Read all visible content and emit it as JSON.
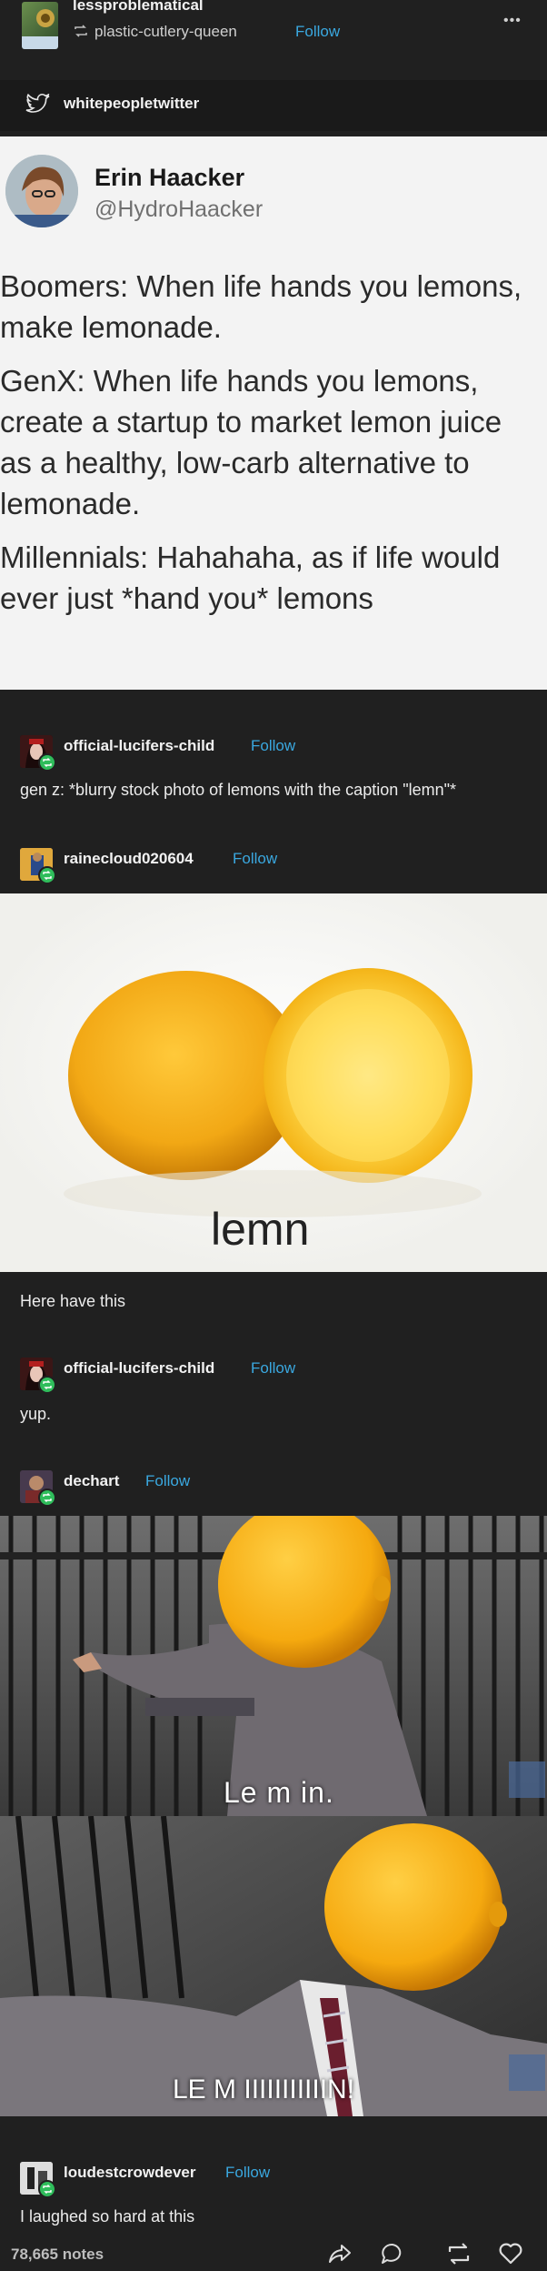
{
  "header": {
    "blog": "lessproblematical",
    "reblogged_from": "plastic-cutlery-queen",
    "follow": "Follow",
    "more": "•••"
  },
  "source": {
    "name": "whitepeopletwitter"
  },
  "tweet": {
    "display_name": "Erin Haacker",
    "handle": "@HydroHaacker",
    "lines": [
      "Boomers: When life hands you lemons,",
      "make lemonade.",
      "GenX: When life hands you lemons,",
      "create a startup to market lemon juice",
      "as a healthy, low-carb alternative to",
      "lemonade.",
      "Millennials: Hahahaha, as if life would",
      "ever just *hand you* lemons"
    ]
  },
  "reblogs": [
    {
      "user": "official-lucifers-child",
      "follow": "Follow",
      "text": "gen z: *blurry stock photo of lemons with the caption \"lemn\"*"
    },
    {
      "user": "rainecloud020604",
      "follow": "Follow",
      "image_caption": "lemn",
      "text": "Here have this"
    },
    {
      "user": "official-lucifers-child",
      "follow": "Follow",
      "text": "yup."
    },
    {
      "user": "dechart",
      "follow": "Follow",
      "meme_top": "Le m in.",
      "meme_bottom": "LE M IIIIIIIIIIIN!"
    },
    {
      "user": "loudestcrowdever",
      "follow": "Follow",
      "text": "I laughed so hard at this"
    }
  ],
  "footer": {
    "notes": "78,665 notes"
  },
  "colors": {
    "background": "#202020",
    "follow": "#3aa8e0",
    "reblog_badge": "#2fbd5b",
    "lemon": "#f5b21a"
  }
}
